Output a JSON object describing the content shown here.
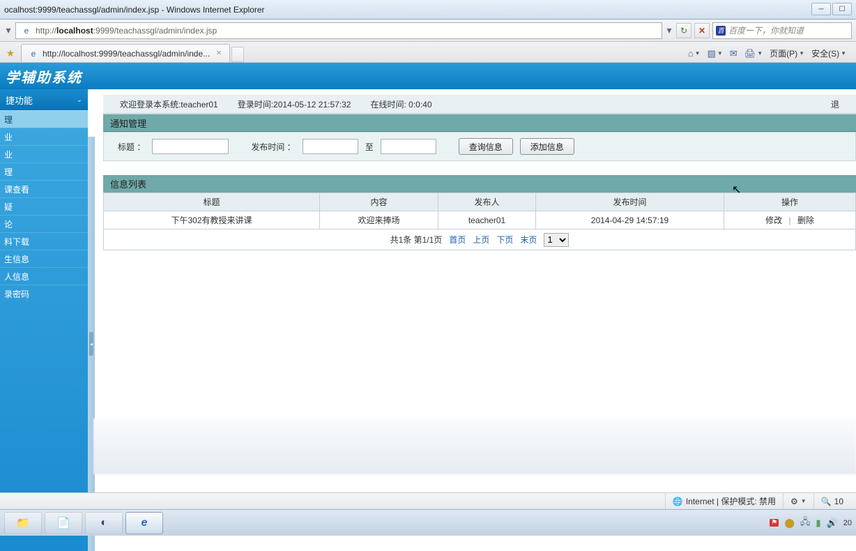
{
  "window": {
    "title": "ocalhost:9999/teachassgl/admin/index.jsp - Windows Internet Explorer"
  },
  "address": {
    "url_prefix": "http://",
    "url_host": "localhost",
    "url_rest": ":9999/teachassgl/admin/index.jsp",
    "search_placeholder": "百度一下，你就知道"
  },
  "tab": {
    "label": "http://localhost:9999/teachassgl/admin/inde..."
  },
  "toolbar": {
    "page_menu": "页面(P)",
    "safety_menu": "安全(S)"
  },
  "app": {
    "banner": "学辅助系统",
    "sidebar_header": "捷功能",
    "sidebar_items": [
      "理",
      "业",
      "业",
      "理",
      "课查看",
      "疑",
      "论",
      "料下载",
      "生信息",
      "人信息",
      "录密码"
    ]
  },
  "welcome": {
    "greeting": "欢迎登录本系统:teacher01",
    "login_time": "登录时间:2014-05-12 21:57:32",
    "online_time": "在线时间: 0:0:40",
    "logout": "退"
  },
  "notice_panel": {
    "title": "通知管理",
    "label_title": "标题 ：",
    "label_publish": "发布时间 ：",
    "label_to": "至",
    "btn_query": "查询信息",
    "btn_add": "添加信息"
  },
  "list": {
    "title": "信息列表",
    "columns": [
      "标题",
      "内容",
      "发布人",
      "发布时间",
      "操作"
    ],
    "rows": [
      {
        "title": "下午302有教授来讲课",
        "content": "欢迎来捧场",
        "publisher": "teacher01",
        "time": "2014-04-29 14:57:19",
        "edit": "修改",
        "delete": "删除"
      }
    ],
    "pager": {
      "summary": "共1条 第1/1页",
      "first": "首页",
      "prev": "上页",
      "next": "下页",
      "last": "末页",
      "current": "1"
    }
  },
  "status": {
    "zone": "Internet | 保护模式: 禁用",
    "zoom": "10"
  },
  "tray": {
    "time": "20"
  }
}
